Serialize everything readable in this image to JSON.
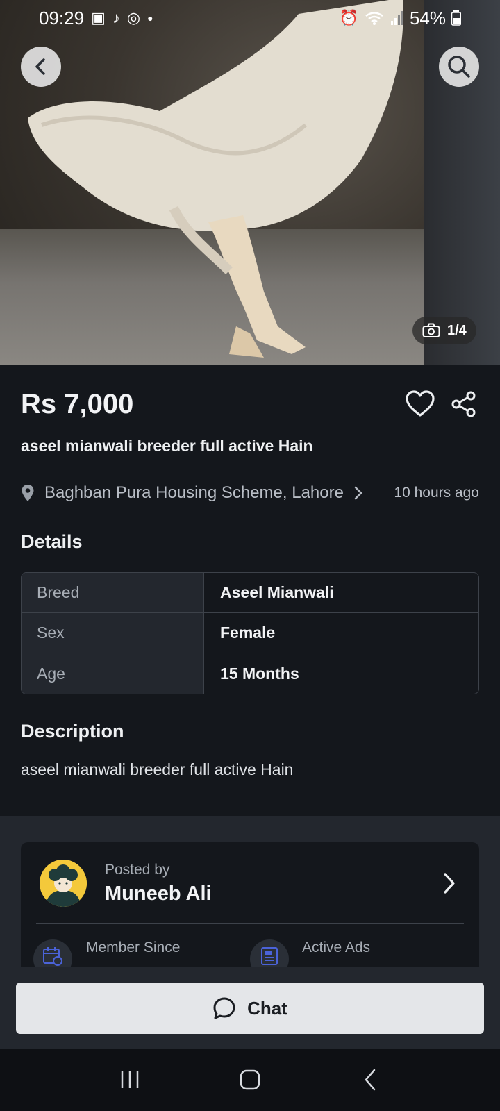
{
  "status_bar": {
    "time": "09:29",
    "battery": "54%",
    "left_icons": [
      "gallery-icon",
      "tiktok-icon",
      "sync-icon",
      "dot-icon"
    ],
    "right_icons": [
      "alarm-icon",
      "wifi-icon",
      "signal-icon",
      "battery-icon"
    ]
  },
  "gallery": {
    "counter": "1/4"
  },
  "listing": {
    "price": "Rs 7,000",
    "title": "aseel mianwali breeder full active Hain",
    "location": "Baghban Pura Housing Scheme, Lahore",
    "posted_time": "10 hours ago"
  },
  "details": {
    "heading": "Details",
    "rows": [
      {
        "key": "Breed",
        "value": "Aseel Mianwali"
      },
      {
        "key": "Sex",
        "value": "Female"
      },
      {
        "key": "Age",
        "value": "15 Months"
      }
    ]
  },
  "description": {
    "heading": "Description",
    "text": "aseel mianwali breeder full active Hain"
  },
  "seller": {
    "posted_by_label": "Posted by",
    "name": "Muneeb Ali",
    "member_since_label": "Member Since",
    "active_ads_label": "Active Ads"
  },
  "actions": {
    "chat_label": "Chat"
  },
  "colors": {
    "background": "#14171c",
    "card_alt": "#23272e",
    "chat_button": "#e4e6e9",
    "accent_icon": "#4b63d9",
    "avatar_bg": "#f4c93b"
  }
}
